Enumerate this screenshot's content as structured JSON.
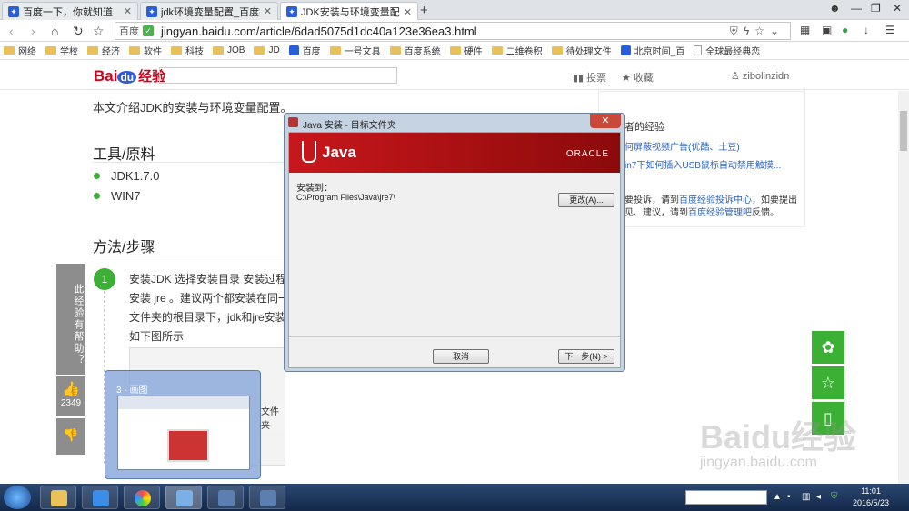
{
  "browser": {
    "tabs": [
      {
        "title": "百度一下，你就知道",
        "active": false
      },
      {
        "title": "jdk环境变量配置_百度搜索",
        "active": false
      },
      {
        "title": "JDK安装与环境变量配置_百度",
        "active": true
      }
    ],
    "new_tab": "+",
    "address": {
      "site_label": "百度",
      "url": "jingyan.baidu.com/article/6dad5075d1dc40a123e36ea3.html"
    },
    "bookmarks": [
      {
        "label": "网络",
        "type": "folder"
      },
      {
        "label": "学校",
        "type": "folder"
      },
      {
        "label": "经济",
        "type": "folder"
      },
      {
        "label": "软件",
        "type": "folder"
      },
      {
        "label": "科技",
        "type": "folder"
      },
      {
        "label": "JOB",
        "type": "folder"
      },
      {
        "label": "JD",
        "type": "folder"
      },
      {
        "label": "百度",
        "type": "site"
      },
      {
        "label": "一号文具",
        "type": "folder"
      },
      {
        "label": "百度系统",
        "type": "folder"
      },
      {
        "label": "硬件",
        "type": "folder"
      },
      {
        "label": "二维卷积",
        "type": "folder"
      },
      {
        "label": "待处理文件",
        "type": "folder"
      },
      {
        "label": "北京时间_百",
        "type": "site"
      },
      {
        "label": "全球最经典恋",
        "type": "page"
      }
    ]
  },
  "page": {
    "logo": {
      "text": "Bai",
      "du": "du",
      "suffix": "经验"
    },
    "header_links": {
      "vote": "投票",
      "collect": "收藏",
      "user": "zibolinzidn"
    },
    "intro": "本文介绍JDK的安装与环境变量配置。",
    "tools_heading": "工具/原料",
    "tools": [
      "JDK1.7.0",
      "WIN7"
    ],
    "steps_heading": "方法/步骤",
    "step": {
      "number": "1",
      "lines": [
        "安装JDK 选择安装目录 安装过程",
        "安装 jre 。建议两个都安装在同一",
        "文件夹的根目录下，jdk和jre安装",
        "如下图所示"
      ]
    },
    "vote_bar": {
      "helpful": "此经验有帮助？",
      "count": "2349"
    },
    "sidebar": {
      "heading": "者的经验",
      "links": [
        "何屏蔽视频广告(优酷、土豆)",
        "in7下如何插入USB鼠标自动禁用触摸..."
      ],
      "feedback_prefix": "要投诉，请到",
      "feedback_link1": "百度经验投诉中心",
      "feedback_mid": "，如要提出",
      "feedback_line2_prefix": "见、建议，请到",
      "feedback_link2": "百度经验管理吧",
      "feedback_suffix": "反馈。"
    },
    "watermark": {
      "main": "Baidu经验",
      "sub": "jingyan.baidu.com"
    }
  },
  "dialog": {
    "title": "Java 安装 - 目标文件夹",
    "close": "✕",
    "brand": "Java",
    "vendor": "ORACLE",
    "install_to_label": "安装到：",
    "install_path": "C:\\Program Files\\Java\\jre7\\",
    "change_button": "更改(A)...",
    "cancel_button": "取消",
    "next_button": "下一步(N) >"
  },
  "taskbar": {
    "thumbnail_title": "3 - 画图",
    "thumbnail_snippet": "文件夹",
    "clock_time": "11:01",
    "clock_date": "2016/5/23"
  }
}
